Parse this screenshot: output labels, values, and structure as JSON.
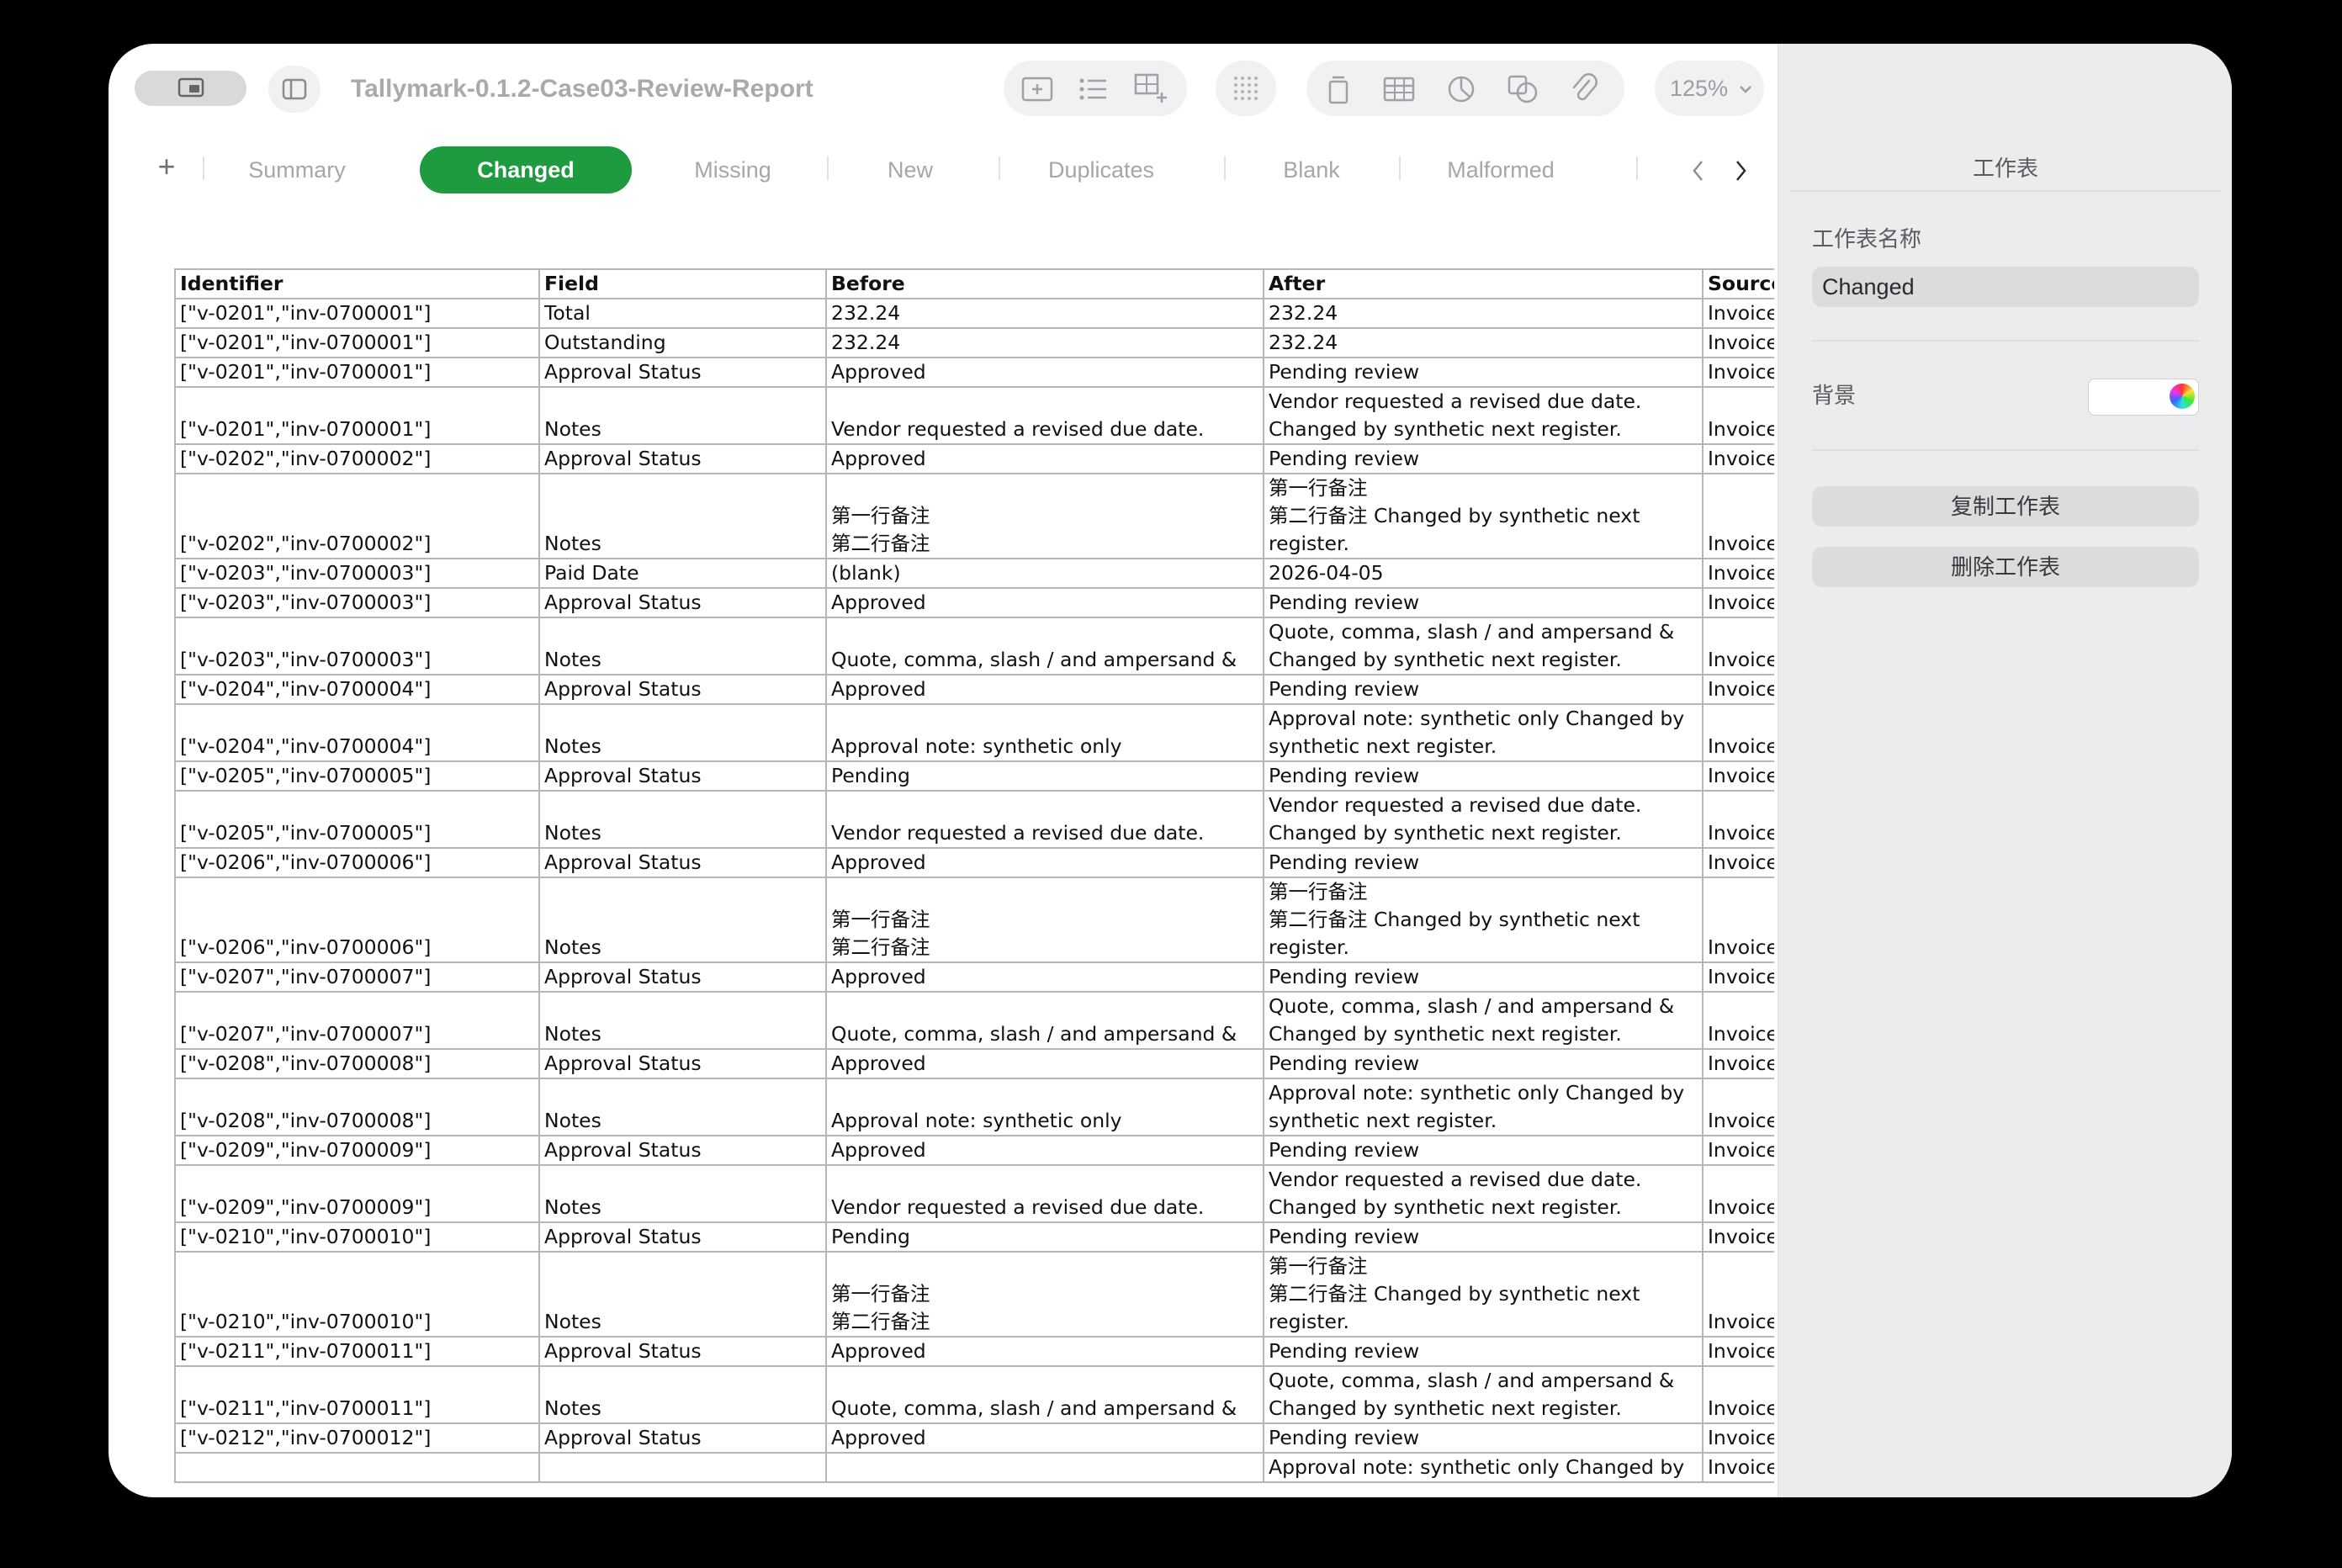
{
  "document": {
    "title": "Tallymark-0.1.2-Case03-Review-Report"
  },
  "toolbar": {
    "zoom": "125%",
    "icons": [
      "sidebar-toggle-icon",
      "view-icon",
      "insert-table-icon",
      "list-icon",
      "add-cells-icon",
      "grid-icon",
      "text-box-icon",
      "table-icon",
      "chart-icon",
      "shape-icon",
      "media-icon",
      "comment-icon",
      "share-icon",
      "format-brush-icon",
      "organize-icon"
    ]
  },
  "tabs": {
    "add_label": "+",
    "items": [
      {
        "label": "Summary",
        "active": false
      },
      {
        "label": "Changed",
        "active": true
      },
      {
        "label": "Missing",
        "active": false
      },
      {
        "label": "New",
        "active": false
      },
      {
        "label": "Duplicates",
        "active": false
      },
      {
        "label": "Blank",
        "active": false
      },
      {
        "label": "Malformed",
        "active": false
      }
    ]
  },
  "table": {
    "headers": [
      "Identifier",
      "Field",
      "Before",
      "After",
      "Source"
    ],
    "rows": [
      [
        "[\"v-0201\",\"inv-0700001\"]",
        "Total",
        "232.24",
        "232.24",
        "Invoices"
      ],
      [
        "[\"v-0201\",\"inv-0700001\"]",
        "Outstanding",
        "232.24",
        "232.24",
        "Invoices"
      ],
      [
        "[\"v-0201\",\"inv-0700001\"]",
        "Approval Status",
        "Approved",
        "Pending review",
        "Invoices"
      ],
      [
        "[\"v-0201\",\"inv-0700001\"]",
        "Notes",
        "Vendor requested a revised due date.",
        "Vendor requested a revised due date.\nChanged by synthetic next register.",
        "Invoices"
      ],
      [
        "[\"v-0202\",\"inv-0700002\"]",
        "Approval Status",
        "Approved",
        "Pending review",
        "Invoices"
      ],
      [
        "[\"v-0202\",\"inv-0700002\"]",
        "Notes",
        "第一行备注\n第二行备注",
        "第一行备注\n第二行备注 Changed by synthetic next\nregister.",
        "Invoices"
      ],
      [
        "[\"v-0203\",\"inv-0700003\"]",
        "Paid Date",
        "(blank)",
        "2026-04-05",
        "Invoices"
      ],
      [
        "[\"v-0203\",\"inv-0700003\"]",
        "Approval Status",
        "Approved",
        "Pending review",
        "Invoices"
      ],
      [
        "[\"v-0203\",\"inv-0700003\"]",
        "Notes",
        "Quote, comma, slash / and ampersand &",
        "Quote, comma, slash / and ampersand &\nChanged by synthetic next register.",
        "Invoices"
      ],
      [
        "[\"v-0204\",\"inv-0700004\"]",
        "Approval Status",
        "Approved",
        "Pending review",
        "Invoices"
      ],
      [
        "[\"v-0204\",\"inv-0700004\"]",
        "Notes",
        "Approval note: synthetic only",
        "Approval note: synthetic only Changed by\nsynthetic next register.",
        "Invoices"
      ],
      [
        "[\"v-0205\",\"inv-0700005\"]",
        "Approval Status",
        "Pending",
        "Pending review",
        "Invoices"
      ],
      [
        "[\"v-0205\",\"inv-0700005\"]",
        "Notes",
        "Vendor requested a revised due date.",
        "Vendor requested a revised due date.\nChanged by synthetic next register.",
        "Invoices"
      ],
      [
        "[\"v-0206\",\"inv-0700006\"]",
        "Approval Status",
        "Approved",
        "Pending review",
        "Invoices"
      ],
      [
        "[\"v-0206\",\"inv-0700006\"]",
        "Notes",
        "第一行备注\n第二行备注",
        "第一行备注\n第二行备注 Changed by synthetic next\nregister.",
        "Invoices"
      ],
      [
        "[\"v-0207\",\"inv-0700007\"]",
        "Approval Status",
        "Approved",
        "Pending review",
        "Invoices"
      ],
      [
        "[\"v-0207\",\"inv-0700007\"]",
        "Notes",
        "Quote, comma, slash / and ampersand &",
        "Quote, comma, slash / and ampersand &\nChanged by synthetic next register.",
        "Invoices"
      ],
      [
        "[\"v-0208\",\"inv-0700008\"]",
        "Approval Status",
        "Approved",
        "Pending review",
        "Invoices"
      ],
      [
        "[\"v-0208\",\"inv-0700008\"]",
        "Notes",
        "Approval note: synthetic only",
        "Approval note: synthetic only Changed by\nsynthetic next register.",
        "Invoices"
      ],
      [
        "[\"v-0209\",\"inv-0700009\"]",
        "Approval Status",
        "Approved",
        "Pending review",
        "Invoices"
      ],
      [
        "[\"v-0209\",\"inv-0700009\"]",
        "Notes",
        "Vendor requested a revised due date.",
        "Vendor requested a revised due date.\nChanged by synthetic next register.",
        "Invoices"
      ],
      [
        "[\"v-0210\",\"inv-0700010\"]",
        "Approval Status",
        "Pending",
        "Pending review",
        "Invoices"
      ],
      [
        "[\"v-0210\",\"inv-0700010\"]",
        "Notes",
        "第一行备注\n第二行备注",
        "第一行备注\n第二行备注 Changed by synthetic next\nregister.",
        "Invoices"
      ],
      [
        "[\"v-0211\",\"inv-0700011\"]",
        "Approval Status",
        "Approved",
        "Pending review",
        "Invoices"
      ],
      [
        "[\"v-0211\",\"inv-0700011\"]",
        "Notes",
        "Quote, comma, slash / and ampersand &",
        "Quote, comma, slash / and ampersand &\nChanged by synthetic next register.",
        "Invoices"
      ],
      [
        "[\"v-0212\",\"inv-0700012\"]",
        "Approval Status",
        "Approved",
        "Pending review",
        "Invoices"
      ],
      [
        "",
        "",
        "",
        "Approval note: synthetic only Changed by",
        "Invoices"
      ]
    ]
  },
  "inspector": {
    "title": "工作表",
    "sheet_name_label": "工作表名称",
    "sheet_name_value": "Changed",
    "background_label": "背景",
    "duplicate_label": "复制工作表",
    "delete_label": "删除工作表"
  },
  "colors": {
    "accent": "#1e9b3f",
    "window_bg": "#ffffff",
    "inspector_bg": "#ececee"
  }
}
